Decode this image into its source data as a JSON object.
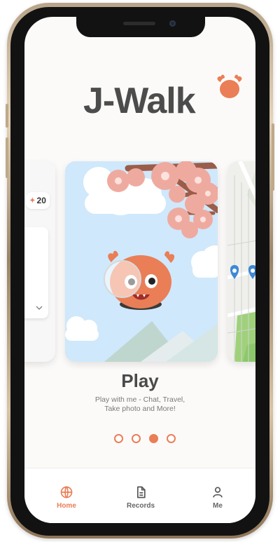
{
  "app": {
    "name": "J-Walk"
  },
  "carousel": {
    "left_card_badge": "20",
    "title": "Play",
    "description": "Play with me - Chat, Travel,\nTake photo and More!",
    "pages": 4,
    "active_page": 3
  },
  "tabbar": {
    "items": [
      {
        "label": "Home",
        "icon": "globe-icon",
        "active": true
      },
      {
        "label": "Records",
        "icon": "document-icon",
        "active": false
      },
      {
        "label": "Me",
        "icon": "profile-icon",
        "active": false
      }
    ]
  },
  "colors": {
    "accent": "#ea7e57",
    "text_dark": "#4a4a4a",
    "sky": "#cfe8fb",
    "blossom": "#efaaa0"
  }
}
